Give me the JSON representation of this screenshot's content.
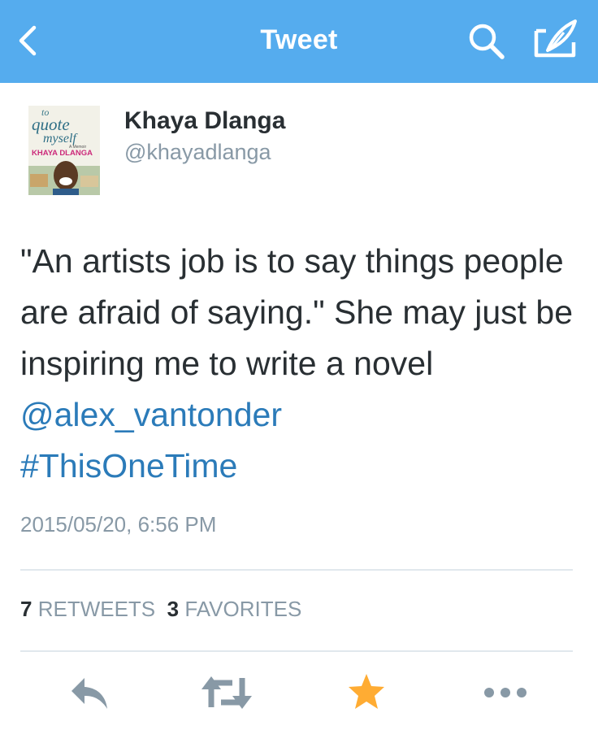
{
  "navbar": {
    "title": "Tweet",
    "color": "#55acee",
    "icons": [
      "chevron-left-icon",
      "search-icon",
      "compose-icon"
    ]
  },
  "author": {
    "name": "Khaya Dlanga",
    "handle": "@khayadlanga",
    "avatar": {
      "title_line1": "to",
      "title_line2": "quote",
      "title_line3": "myself",
      "subtitle": "A Memoir",
      "author_text": "KHAYA DLANGA"
    }
  },
  "tweet": {
    "text_plain": "\"An artists job is to say things people are afraid of saying.\" She may just be inspiring me to write a novel ",
    "mention": "@alex_vantonder",
    "hashtag": "#ThisOneTime",
    "timestamp": "2015/05/20, 6:56 PM",
    "link_color": "#2b7bb9"
  },
  "stats": {
    "retweets_count": "7",
    "retweets_label": "RETWEETS",
    "favorites_count": "3",
    "favorites_label": "FAVORITES"
  },
  "actions": {
    "icons": [
      "reply-icon",
      "retweet-icon",
      "favorite-star-icon",
      "more-icon"
    ],
    "favorite_color": "#ffac33"
  }
}
